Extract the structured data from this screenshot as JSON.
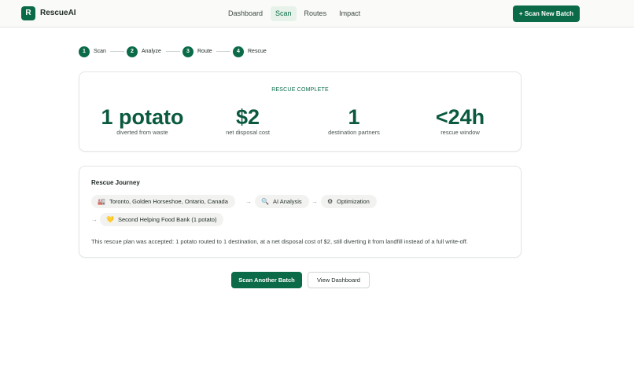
{
  "brand": {
    "logo_letter": "R",
    "name": "RescueAI"
  },
  "nav": {
    "items": [
      {
        "label": "Dashboard"
      },
      {
        "label": "Scan"
      },
      {
        "label": "Routes"
      },
      {
        "label": "Impact"
      }
    ],
    "active": "Scan"
  },
  "header": {
    "scan_button": "+ Scan New Batch"
  },
  "stepper": {
    "steps": [
      {
        "number": "1",
        "label": "Scan"
      },
      {
        "number": "2",
        "label": "Analyze"
      },
      {
        "number": "3",
        "label": "Route"
      },
      {
        "number": "4",
        "label": "Rescue"
      }
    ]
  },
  "summary": {
    "status_label": "RESCUE COMPLETE",
    "stats": [
      {
        "value": "1 potato",
        "label": "diverted from waste"
      },
      {
        "value": "$2",
        "label": "net disposal cost"
      },
      {
        "value": "1",
        "label": "destination partners"
      },
      {
        "value": "<24h",
        "label": "rescue window"
      }
    ]
  },
  "journey": {
    "title": "Rescue Journey",
    "chips": [
      {
        "icon": "🏭",
        "icon_name": "factory-icon",
        "label": "Toronto, Golden Horseshoe, Ontario, Canada"
      },
      {
        "icon": "🔍",
        "icon_name": "search-icon",
        "label": "AI Analysis"
      },
      {
        "icon": "⚙",
        "icon_name": "gear-icon",
        "label": "Optimization"
      },
      {
        "icon": "💛",
        "icon_name": "heart-icon",
        "label": "Second Helping Food Bank (1 potato)"
      }
    ],
    "arrow": "→",
    "description": "This rescue plan was accepted: 1 potato routed to 1 destination, at a net disposal cost of $2, still diverting it from landfill instead of a full write-off."
  },
  "actions": {
    "primary": "Scan Another Batch",
    "secondary": "View Dashboard"
  },
  "colors": {
    "accent": "#0b6b48",
    "stat_text": "#0b5a3e",
    "chip_bg": "#f2f3f1"
  }
}
